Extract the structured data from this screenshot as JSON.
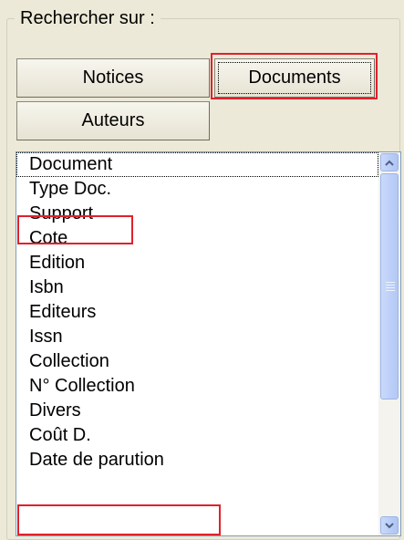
{
  "panel": {
    "legend": "Rechercher sur :"
  },
  "buttons": {
    "notices": "Notices",
    "documents": "Documents",
    "auteurs": "Auteurs"
  },
  "list": {
    "items": [
      "Document",
      "Type Doc.",
      "Support",
      "Cote",
      "Edition",
      "Isbn",
      "Editeurs",
      "Issn",
      "Collection",
      "N° Collection",
      "Divers",
      "Coût D.",
      "Date de parution"
    ]
  },
  "scrollbar": {
    "up_icon": "scroll-up-arrow-icon",
    "down_icon": "scroll-down-arrow-icon"
  },
  "colors": {
    "highlight": "#e0212b",
    "background": "#ece9d8"
  }
}
